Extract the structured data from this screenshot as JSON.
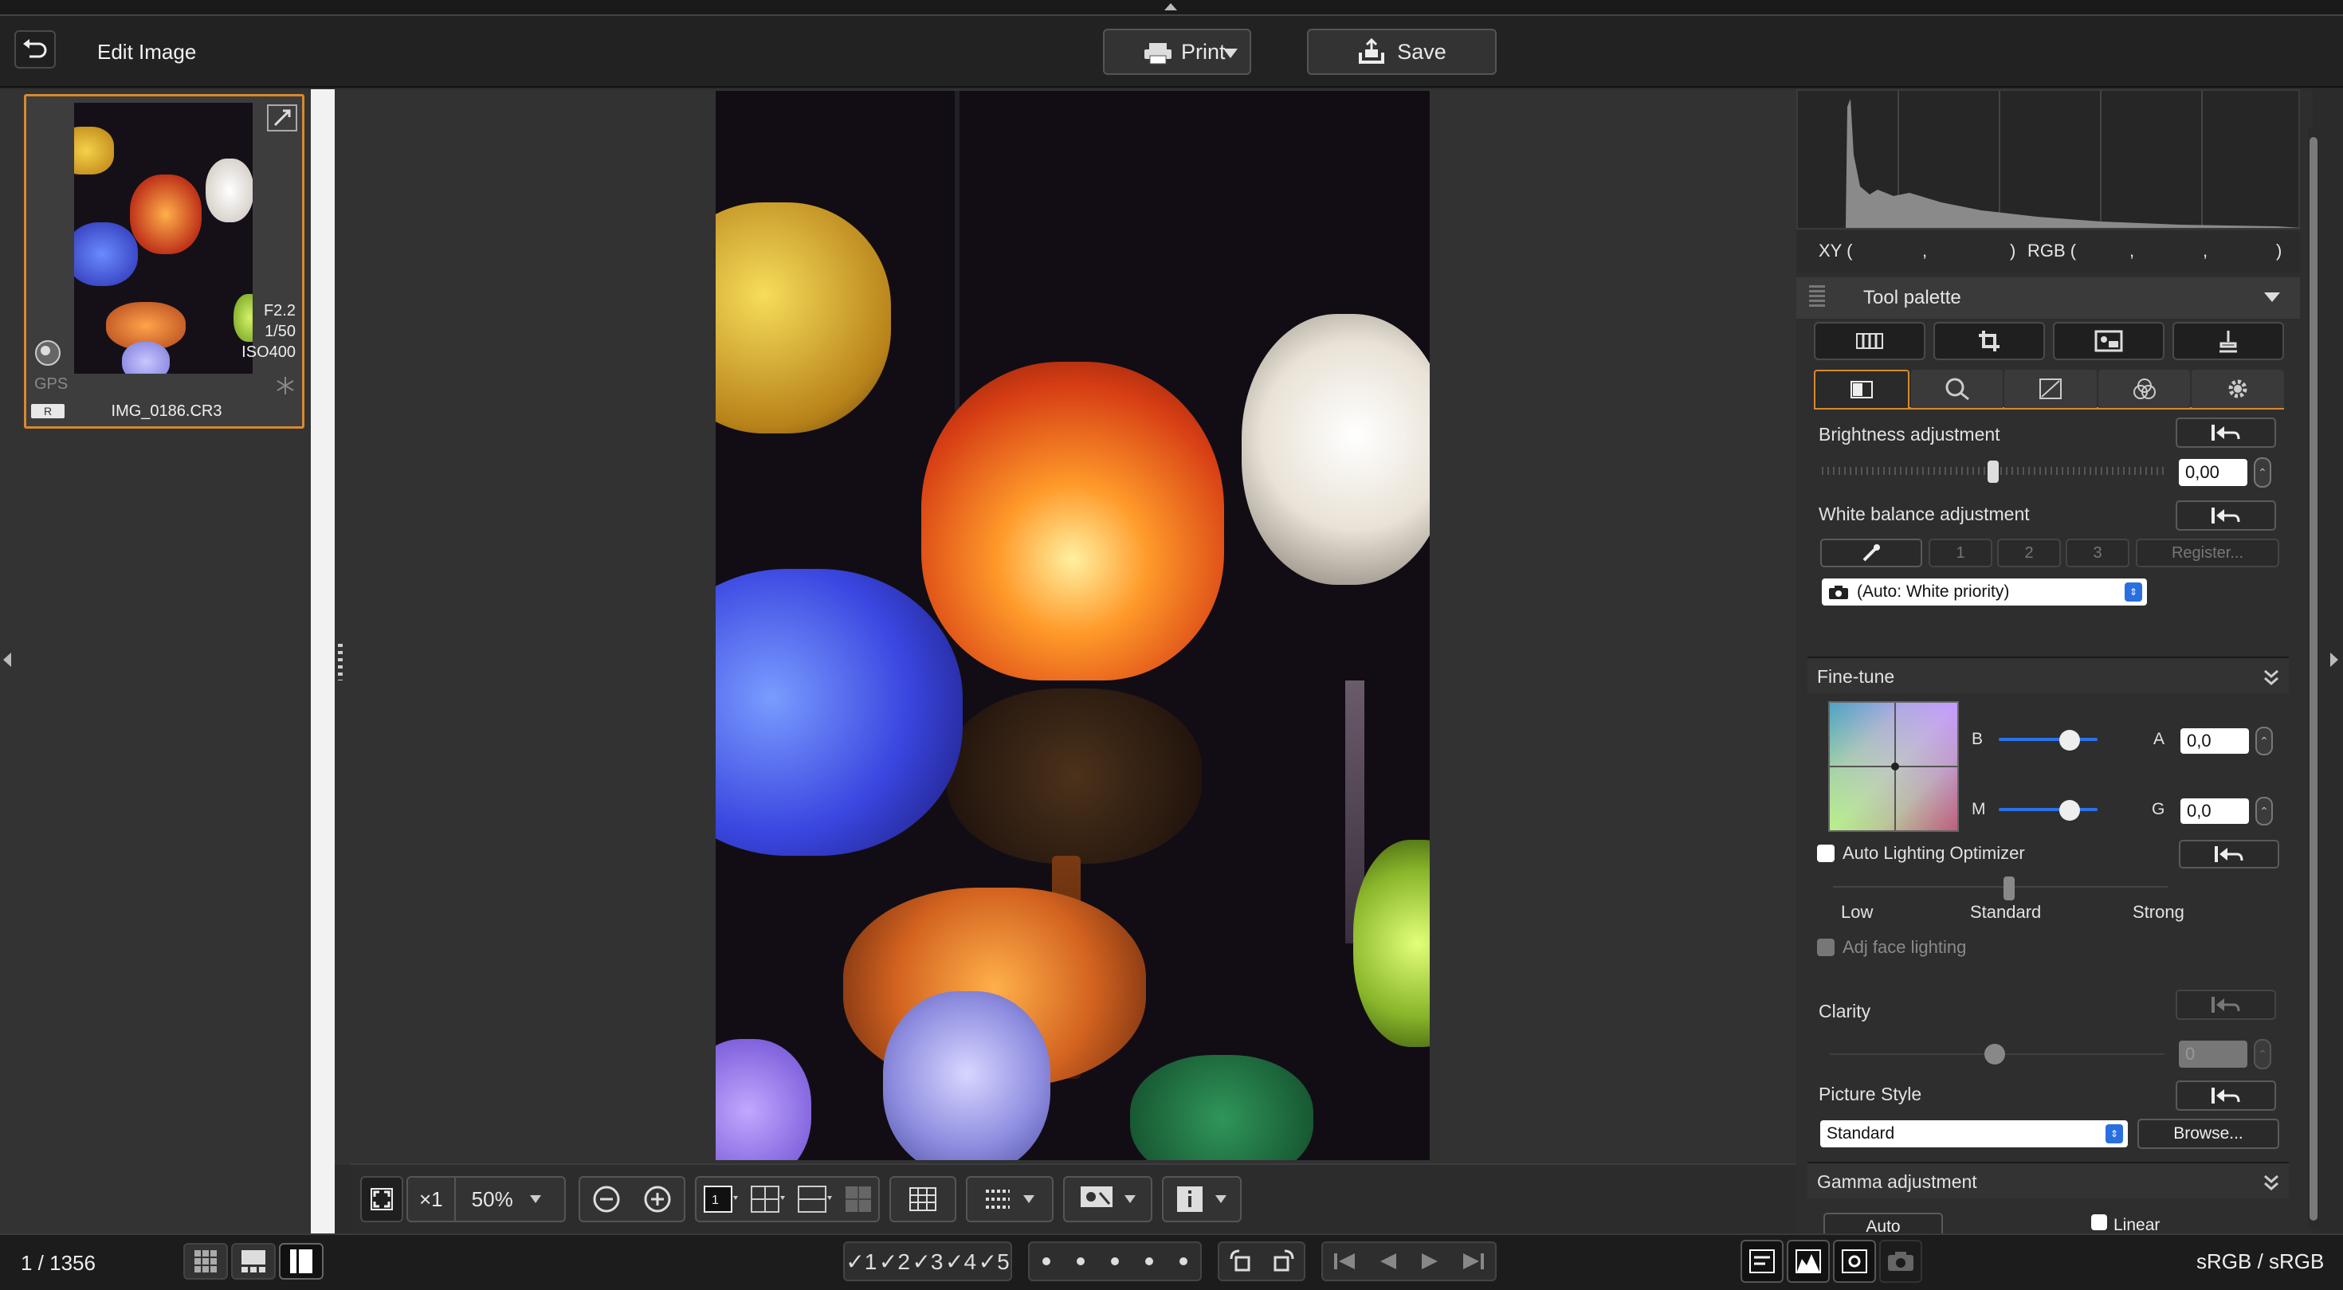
{
  "header": {
    "title": "Edit Image",
    "print_label": "Print",
    "save_label": "Save"
  },
  "thumbnail": {
    "aperture": "F2.2",
    "shutter": "1/50",
    "iso": "ISO400",
    "gps": "GPS",
    "raw_badge": "R",
    "filename": "IMG_0186.CR3"
  },
  "status": {
    "count": "1 / 1356",
    "color_space": "sRGB / sRGB"
  },
  "viewer_toolbar": {
    "zoom_x1": "×1",
    "zoom_value": "50%"
  },
  "histogram": {
    "xy_label": "XY (",
    "comma1": ",",
    "close1": ")",
    "rgb_label": "RGB (",
    "comma2": ",",
    "comma3": ",",
    "close2": ")"
  },
  "tool_palette": {
    "title": "Tool palette",
    "brightness": {
      "label": "Brightness adjustment",
      "value": "0,00",
      "level": 0.5
    },
    "white_balance": {
      "label": "White balance adjustment",
      "slots": [
        "1",
        "2",
        "3"
      ],
      "register_label": "Register...",
      "mode": "(Auto: White priority)"
    },
    "fine_tune": {
      "title": "Fine-tune",
      "b_label": "B",
      "a_label": "A",
      "a_value": "0,0",
      "m_label": "M",
      "g_label": "G",
      "g_value": "0,0"
    },
    "alo": {
      "label": "Auto Lighting Optimizer",
      "low": "Low",
      "standard": "Standard",
      "strong": "Strong",
      "face_label": "Adj face lighting",
      "checked": false
    },
    "clarity": {
      "label": "Clarity",
      "value": "0"
    },
    "picture_style": {
      "label": "Picture Style",
      "value": "Standard",
      "browse_label": "Browse..."
    },
    "gamma": {
      "title": "Gamma adjustment",
      "auto_label": "Auto",
      "linear_label": "Linear"
    }
  },
  "colors": {
    "accent": "#d7892e",
    "panel": "#2f2f2f",
    "field_bg": "#ffffff",
    "toolbar_bg": "#1e1e1e"
  },
  "icons": [
    "back-arrow-icon",
    "printer-icon",
    "save-icon",
    "fullscreen-icon",
    "zoom-out-icon",
    "zoom-in-icon",
    "grid-icon",
    "info-icon",
    "eyedropper-icon",
    "camera-icon",
    "revert-icon",
    "settings-icon"
  ]
}
